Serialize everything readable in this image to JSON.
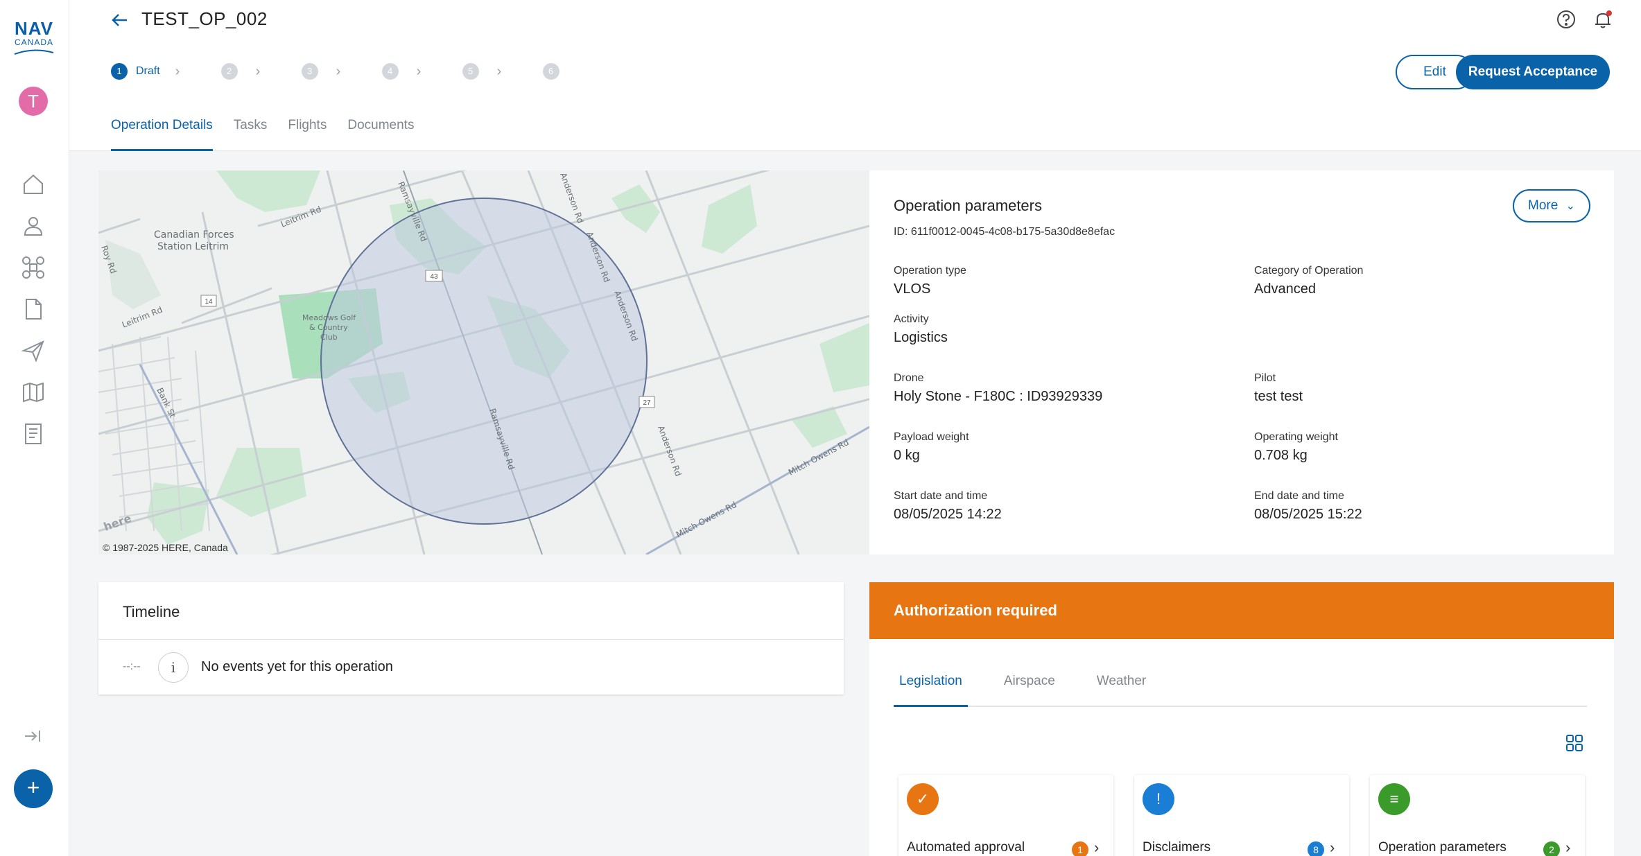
{
  "app": {
    "logo_top": "NAV",
    "logo_bottom": "CANADA",
    "avatar_initial": "T",
    "fab_label": "+"
  },
  "header": {
    "title": "TEST_OP_002",
    "stepper": {
      "steps": [
        "1",
        "2",
        "3",
        "4",
        "5",
        "6"
      ],
      "active_label": "Draft"
    },
    "edit_label": "Edit",
    "request_label": "Request Acceptance",
    "tabs": [
      "Operation Details",
      "Tasks",
      "Flights",
      "Documents"
    ],
    "active_tab": "Operation Details"
  },
  "map": {
    "labels": {
      "station": "Canadian Forces",
      "station2": "Station Leitrim",
      "leitrim_rd": "Leitrim Rd",
      "leitrim_rd2": "Leitrim Rd",
      "ramsayville_rd": "Ramsayville Rd",
      "ramsayville_rd2": "Ramsayville Rd",
      "anderson_rd": "Anderson Rd",
      "anderson_rd2": "Anderson Rd",
      "anderson_rd3": "Anderson Rd",
      "anderson_rd4": "Anderson Rd",
      "golf1": "Meadows Golf",
      "golf2": "& Country",
      "golf3": "Club",
      "bank_st": "Bank St",
      "mitch1": "Mitch Owens Rd",
      "mitch2": "Mitch Owens Rd",
      "roy_rd": "Roy Rd",
      "route14": "14",
      "route43": "43",
      "route27": "27",
      "here": "here"
    },
    "copyright": "© 1987-2025 HERE, Canada"
  },
  "params": {
    "title": "Operation parameters",
    "id_text": "ID: 611f0012-0045-4c08-b175-5a30d8e8efac",
    "more_label": "More",
    "fields": {
      "operation_type": {
        "label": "Operation type",
        "value": "VLOS"
      },
      "category": {
        "label": "Category of Operation",
        "value": "Advanced"
      },
      "activity": {
        "label": "Activity",
        "value": "Logistics"
      },
      "drone": {
        "label": "Drone",
        "value": "Holy Stone - F180C : ID93929339"
      },
      "pilot": {
        "label": "Pilot",
        "value": "test test"
      },
      "payload": {
        "label": "Payload weight",
        "value": "0 kg"
      },
      "operating": {
        "label": "Operating weight",
        "value": "0.708 kg"
      },
      "start": {
        "label": "Start date and time",
        "value": "08/05/2025 14:22"
      },
      "end": {
        "label": "End date and time",
        "value": "08/05/2025 15:22"
      }
    }
  },
  "timeline": {
    "title": "Timeline",
    "time": "--:--",
    "info_glyph": "i",
    "empty_text": "No events yet for this operation"
  },
  "authorization": {
    "title": "Authorization required",
    "tabs": [
      "Legislation",
      "Airspace",
      "Weather"
    ],
    "active_tab": "Legislation",
    "tiles": [
      {
        "label": "Automated approval",
        "badge": "1",
        "color": "#e67512",
        "glyph": "✓"
      },
      {
        "label": "Disclaimers",
        "badge": "8",
        "color": "#1a7fd4",
        "glyph": "!"
      },
      {
        "label": "Operation parameters",
        "badge": "2",
        "color": "#3a9a2a",
        "glyph": "≡"
      }
    ]
  },
  "colors": {
    "primary": "#0a63a9",
    "warning": "#e67512",
    "avatar": "#e36ba8"
  }
}
